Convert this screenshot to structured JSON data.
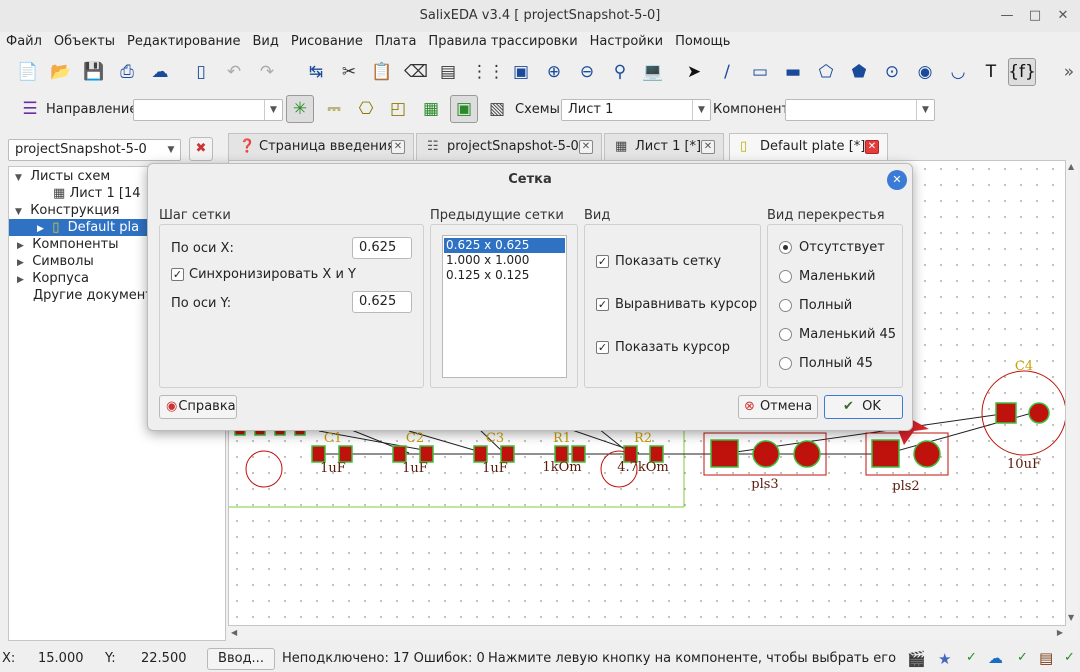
{
  "window": {
    "title": "SalixEDA v3.4 [ projectSnapshot-5-0]"
  },
  "menu": [
    "Файл",
    "Объекты",
    "Редактирование",
    "Вид",
    "Рисование",
    "Плата",
    "Правила трассировки",
    "Настройки",
    "Помощь"
  ],
  "toolbar2": {
    "direction_label": "Направление:",
    "direction_value": "",
    "schemes_label": "Схемы:",
    "schemes_value": "Лист 1",
    "component_label": "Компонент:",
    "component_value": ""
  },
  "project_combo": "projectSnapshot-5-0",
  "tree": {
    "items": [
      "Листы схем",
      "Лист 1 [14",
      "Конструкция",
      "Default pla",
      "Компоненты",
      "Символы",
      "Корпуса",
      "Другие документ"
    ]
  },
  "tabs": [
    "Страница введения",
    "projectSnapshot-5-0",
    "Лист 1 [*]",
    "Default plate [*]"
  ],
  "dialog": {
    "title": "Сетка",
    "grid_step": {
      "title": "Шаг сетки",
      "x_label": "По оси X:",
      "x_value": "0.625",
      "sync_label": "Синхронизировать X и Y",
      "sync_checked": true,
      "y_label": "По оси Y:",
      "y_value": "0.625"
    },
    "previous": {
      "title": "Предыдущие сетки",
      "items": [
        "0.625 x 0.625",
        "1.000 x 1.000",
        "0.125 x 0.125"
      ]
    },
    "view": {
      "title": "Вид",
      "show_grid": "Показать сетку",
      "align_cursor": "Выравнивать курсор",
      "show_cursor": "Показать курсор"
    },
    "cross": {
      "title": "Вид перекрестья",
      "options": [
        "Отсутствует",
        "Маленький",
        "Полный",
        "Маленький 45",
        "Полный 45"
      ],
      "selected": "Отсутствует"
    },
    "help": "Справка",
    "cancel": "Отмена",
    "ok": "OK"
  },
  "pcb": {
    "labels": {
      "c1": "C1",
      "c1v": "1uF",
      "c2": "C2",
      "c2v": "1uF",
      "c3": "C3",
      "c3v": "1uF",
      "r1": "R1",
      "r1v": "1kOm",
      "r2": "R2",
      "r2v": "4.7kOm",
      "pls3": "pls3",
      "pls2": "pls2",
      "c4": "C4",
      "c4v": "10uF"
    }
  },
  "status": {
    "x_label": "X:",
    "x_value": "15.000",
    "y_label": "Y:",
    "y_value": "22.500",
    "input_btn": "Ввод...",
    "info": "Неподключено: 17 Ошибок: 0",
    "hint": "Нажмите левую кнопку на компоненте, чтобы выбрать его для раз"
  },
  "colors": {
    "pad": "#c0120c",
    "pad_border": "#3fbf3f",
    "outline": "#c0120c",
    "board": "#7ccc3a",
    "dialog_accent": "#3a7bd5",
    "selection": "#2f72c4"
  }
}
